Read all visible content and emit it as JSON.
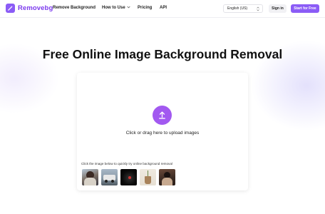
{
  "header": {
    "brand": "Removebg",
    "nav": [
      "Remove Background",
      "How to Use",
      "Pricing",
      "API"
    ],
    "language": "English (US)",
    "signin_label": "Sign in",
    "start_label": "Start for Free"
  },
  "hero": {
    "title": "Free Online Image Background Removal",
    "upload_text": "Click or drag here to upload images",
    "hint": "Click the image below to quickly try online background removal"
  },
  "colors": {
    "brand": "#8b5cf6",
    "upload_button": "#a259f0"
  },
  "icons": {
    "logo": "logo-icon",
    "dropdown": "chevron-down-icon",
    "language_select": "updown-arrows-icon",
    "upload": "upload-arrow-icon"
  }
}
